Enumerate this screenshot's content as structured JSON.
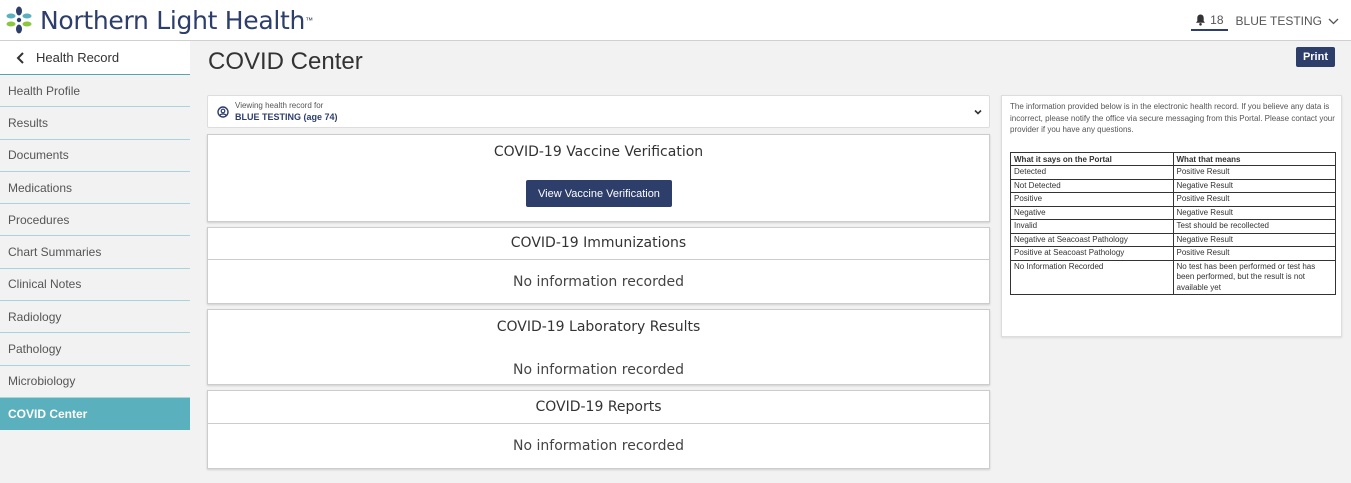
{
  "header": {
    "logo_text": "Northern Light Health",
    "logo_tm": "™",
    "notification_count": "18",
    "user_name": "BLUE TESTING"
  },
  "sidebar": {
    "back_label": "Health Record",
    "items": [
      {
        "label": "Health Profile"
      },
      {
        "label": "Results"
      },
      {
        "label": "Documents"
      },
      {
        "label": "Medications"
      },
      {
        "label": "Procedures"
      },
      {
        "label": "Chart Summaries"
      },
      {
        "label": "Clinical Notes"
      },
      {
        "label": "Radiology"
      },
      {
        "label": "Pathology"
      },
      {
        "label": "Microbiology"
      },
      {
        "label": "COVID Center"
      }
    ]
  },
  "main": {
    "title": "COVID Center",
    "print_label": "Print",
    "viewing": {
      "caption": "Viewing health record for",
      "name": "BLUE TESTING",
      "age": "(age 74)"
    },
    "cards": {
      "vaccine": {
        "title": "COVID-19 Vaccine Verification",
        "button": "View Vaccine Verification"
      },
      "immunizations": {
        "title": "COVID-19 Immunizations",
        "empty": "No information recorded"
      },
      "lab": {
        "title": "COVID-19 Laboratory Results",
        "empty": "No information recorded"
      },
      "reports": {
        "title": "COVID-19 Reports",
        "empty": "No information recorded"
      }
    }
  },
  "info": {
    "text": "The information provided below is in the electronic health record. If you believe any data is incorrect, please notify the office via secure messaging from this Portal. Please contact your provider if you have any questions.",
    "headers": [
      "What it says on the Portal",
      "What that means"
    ],
    "rows": [
      [
        "Detected",
        "Positive Result"
      ],
      [
        "Not Detected",
        "Negative Result"
      ],
      [
        "Positive",
        "Positive Result"
      ],
      [
        "Negative",
        "Negative Result"
      ],
      [
        "Invalid",
        "Test should be recollected"
      ],
      [
        "Negative at Seacoast Pathology",
        "Negative Result"
      ],
      [
        "Positive at Seacoast Pathology",
        "Positive Result"
      ],
      [
        "No Information Recorded",
        "No test has been performed or test has been performed, but the result is not available yet"
      ]
    ]
  },
  "colors": {
    "brand": "#2d3e6b",
    "sidebar_active": "#5ab0bc"
  }
}
